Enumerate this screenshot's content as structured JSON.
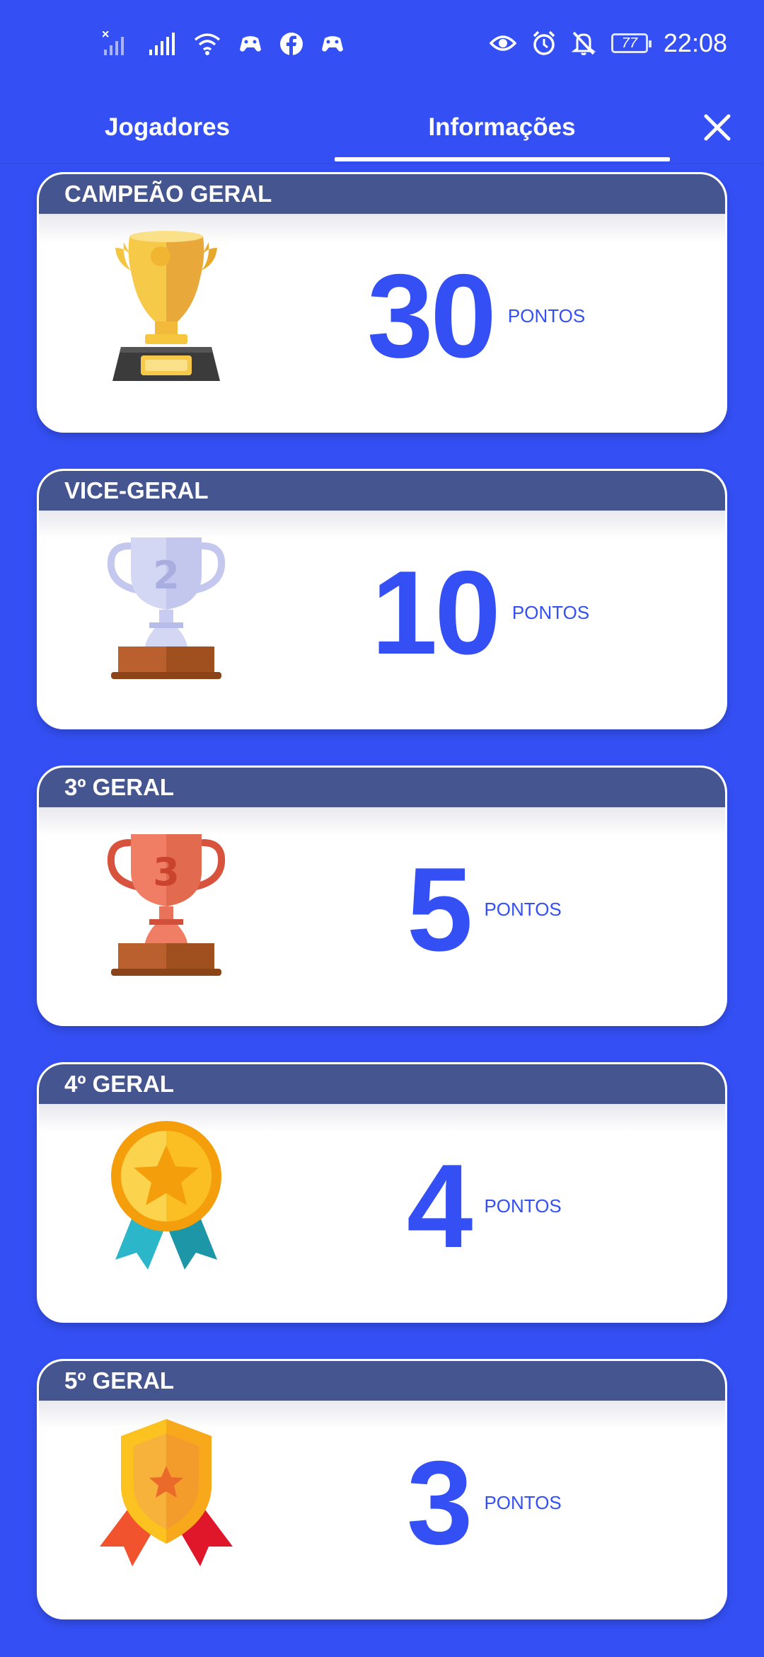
{
  "status_bar": {
    "time": "22:08",
    "battery": "77",
    "icons_left": [
      "no-signal-icon",
      "signal-icon",
      "wifi-icon",
      "gamepad-icon",
      "facebook-icon",
      "gamepad-icon"
    ],
    "icons_right": [
      "eye-icon",
      "alarm-icon",
      "bell-off-icon",
      "battery-icon"
    ]
  },
  "tabs": [
    {
      "label": "Jogadores",
      "active": false
    },
    {
      "label": "Informações",
      "active": true
    }
  ],
  "close_icon": "close-icon",
  "colors": {
    "background": "#3450f5",
    "header": "#455590",
    "accent": "#3450f5"
  },
  "cards": [
    {
      "title": "CAMPEÃO GERAL",
      "points": "30",
      "unit": "PONTOS",
      "icon": "gold-trophy-icon"
    },
    {
      "title": "VICE-GERAL",
      "points": "10",
      "unit": "PONTOS",
      "icon": "silver-trophy-icon"
    },
    {
      "title": "3º GERAL",
      "points": "5",
      "unit": "PONTOS",
      "icon": "bronze-trophy-icon"
    },
    {
      "title": "4º GERAL",
      "points": "4",
      "unit": "PONTOS",
      "icon": "star-medal-icon"
    },
    {
      "title": "5º GERAL",
      "points": "3",
      "unit": "PONTOS",
      "icon": "shield-badge-icon"
    }
  ]
}
